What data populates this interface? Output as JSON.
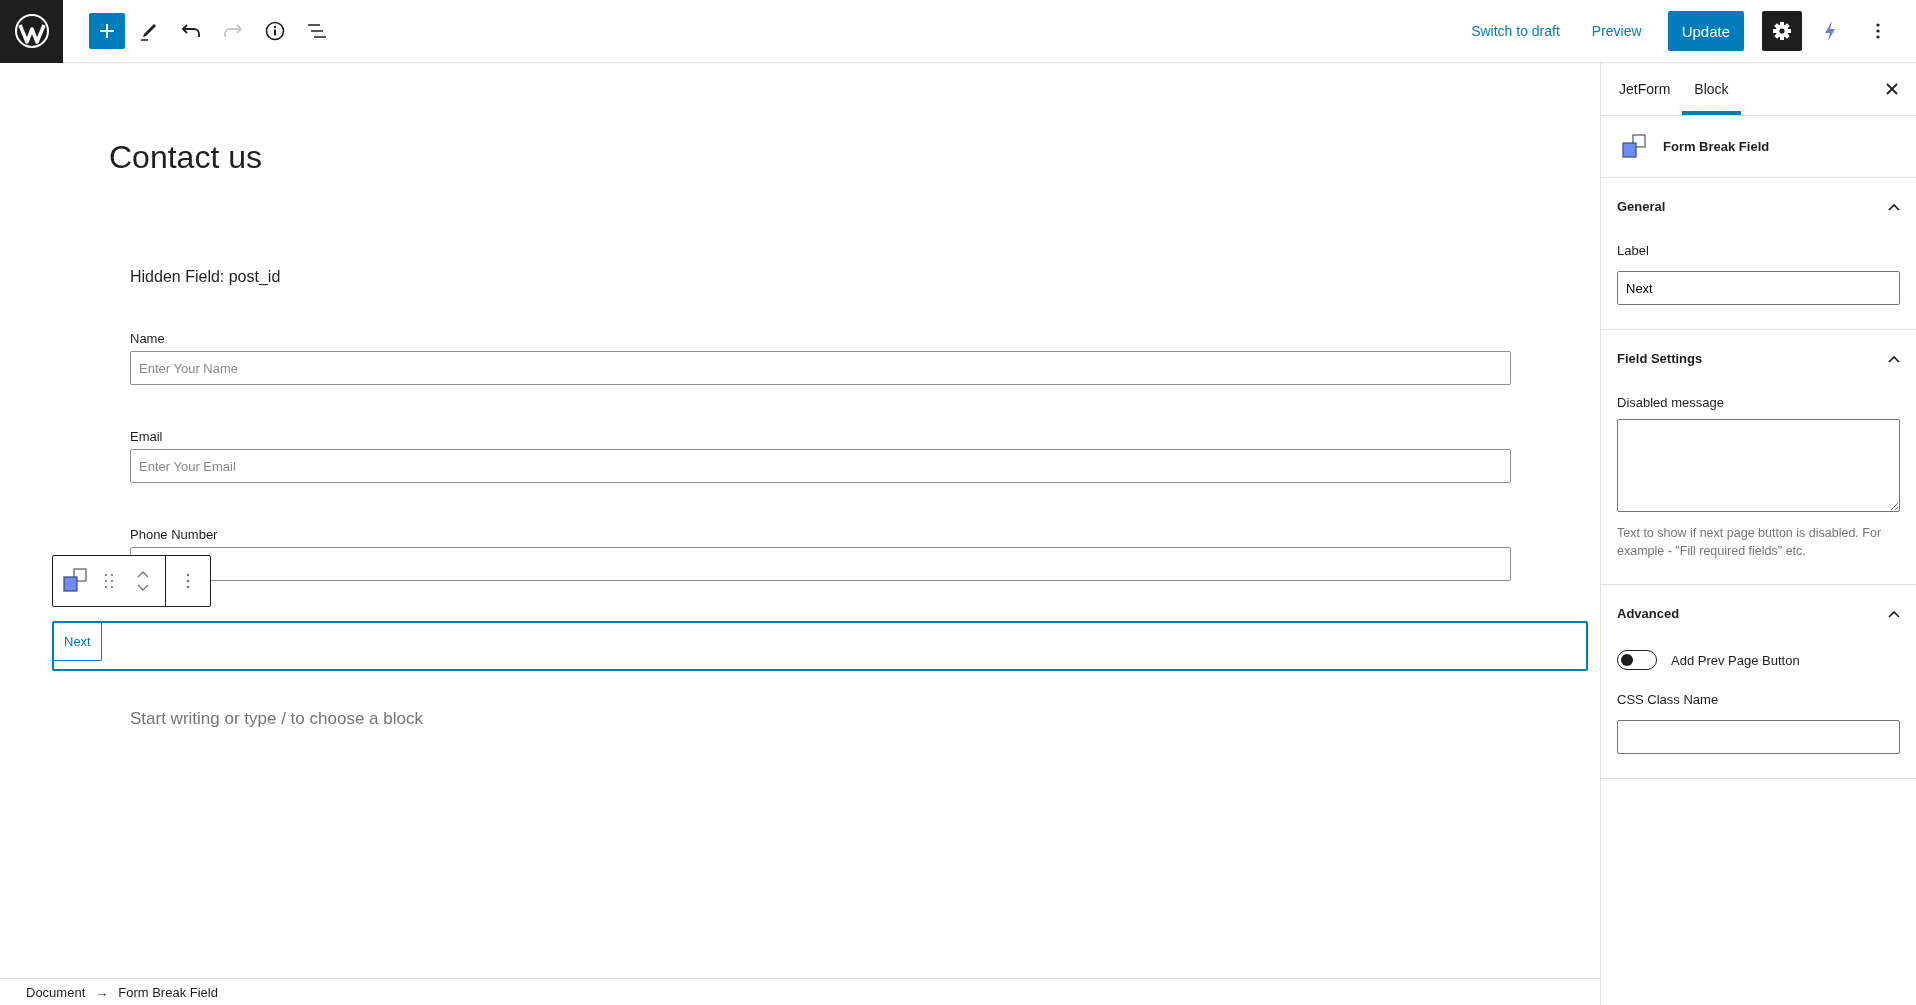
{
  "topbar": {
    "tools": [
      {
        "kind": "add",
        "disabled": false
      },
      {
        "kind": "edit",
        "disabled": false
      },
      {
        "kind": "undo",
        "disabled": false
      },
      {
        "kind": "redo",
        "disabled": true
      },
      {
        "kind": "info",
        "disabled": false
      },
      {
        "kind": "outline",
        "disabled": false
      }
    ],
    "switch_to_draft": "Switch to draft",
    "preview": "Preview",
    "update": "Update",
    "settings": {
      "on": true
    }
  },
  "post_title": "Contact us",
  "blocks": [
    {
      "kind": "hidden",
      "text": "Hidden Field: post_id"
    },
    {
      "kind": "text_field",
      "label": "Name",
      "placeholder": "Enter Your Name"
    },
    {
      "kind": "text_field",
      "label": "Email",
      "placeholder": "Enter Your Email"
    },
    {
      "kind": "text_field",
      "label": "Phone Number"
    },
    {
      "kind": "form_break",
      "button": "Next",
      "selected": true
    }
  ],
  "appender_placeholder": "Start writing or type / to choose a block",
  "sidebar": {
    "tabs": [
      {
        "label": "JetForm",
        "selected": false
      },
      {
        "label": "Block",
        "selected": true
      }
    ],
    "block_title": "Form Break Field",
    "panels": [
      {
        "title": "General",
        "expanded": true,
        "controls": [
          {
            "kind": "text",
            "label": "Label",
            "value": "Next"
          }
        ]
      },
      {
        "title": "Field Settings",
        "expanded": true,
        "controls": [
          {
            "kind": "textarea",
            "label": "Disabled message",
            "help": "Text to show if next page button is disabled. For example - \"Fill required fields\" etc."
          }
        ]
      },
      {
        "title": "Advanced",
        "expanded": true,
        "controls": [
          {
            "kind": "toggle",
            "label": "Add Prev Page Button",
            "on": false
          },
          {
            "kind": "text",
            "label": "CSS Class Name"
          }
        ]
      }
    ]
  },
  "breadcrumb": {
    "items": [
      "Document",
      "Form Break Field"
    ],
    "separator": "→"
  }
}
